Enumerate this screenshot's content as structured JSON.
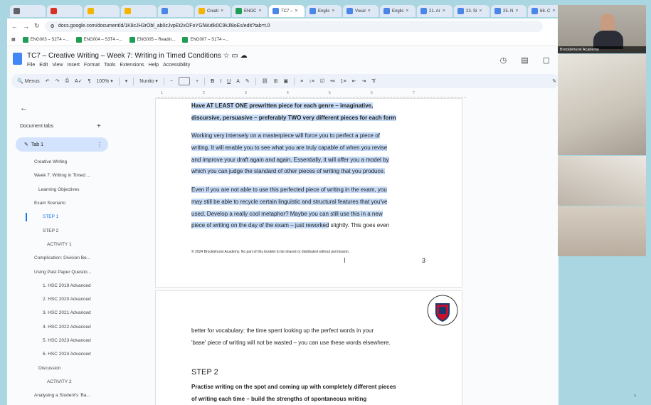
{
  "browser": {
    "tabs": [
      {
        "label": ""
      },
      {
        "label": ""
      },
      {
        "label": ""
      },
      {
        "label": ""
      },
      {
        "label": ""
      },
      {
        "label": "Creati"
      },
      {
        "label": "ENGC"
      },
      {
        "label": "TC7 –"
      },
      {
        "label": "Englis"
      },
      {
        "label": "Vocal"
      },
      {
        "label": "Englis"
      },
      {
        "label": "21. Ar"
      },
      {
        "label": "23. Si"
      },
      {
        "label": "25. N"
      },
      {
        "label": "68. C"
      },
      {
        "label": "75. E"
      }
    ],
    "url": "docs.google.com/document/d/1K8cJH3rObl_ab0zJvpEt2xOFoYGlWutlk0C9kJl8oEs/edit?tab=t.0",
    "bookmarks": [
      "ENG003 – S2T4 –...",
      "ENG004 – S3T4 –...",
      "ENG005 – Readin...",
      "ENG007 – S1T4 –..."
    ]
  },
  "doc": {
    "title": "TC7 – Creative Writing – Week 7: Writing in Timed Conditions",
    "menus": [
      "File",
      "Edit",
      "View",
      "Insert",
      "Format",
      "Tools",
      "Extensions",
      "Help",
      "Accessibility"
    ],
    "toolbar": {
      "search": "Menus",
      "zoom": "100%",
      "font": "Nunito"
    }
  },
  "ruler": [
    "1",
    "2",
    "3",
    "4",
    "5",
    "6",
    "7"
  ],
  "sidebar": {
    "header": "Document tabs",
    "add_icon": "+",
    "current_tab": "Tab 1",
    "outline": [
      "Creative Writing",
      "Week 7: Writing in Timed ...",
      "Learning Objectives",
      "Exam Scenario",
      "STEP 1",
      "STEP 2",
      "ACTIVITY 1",
      "Complication: Division Be...",
      "Using Past Paper Questio...",
      "1. HSC 2019 Advanced",
      "2. HSC 2020 Advanced",
      "3. HSC 2021 Advanced",
      "4. HSC 2022 Advanced",
      "5. HSC 2023 Advanced",
      "6. HSC 2024 Advanced",
      "Discussion",
      "ACTIVITY 2",
      "Analysing a Student's 'Ba...",
      "Echoes"
    ]
  },
  "page1": {
    "heading_line1": "Have AT LEAST ONE prewritten piece for each genre – imaginative,",
    "heading_line2": "discursive, persuasive – preferably TWO very different pieces for each form",
    "para1": [
      "Working very intensely on a masterpiece will force you to perfect a piece of",
      "writing. It will enable you to see what you are truly capable of when you revise",
      "and improve your draft again and again. Essentially, it will offer you a model by",
      "which you can judge the standard of other pieces of writing that you produce."
    ],
    "para2": [
      "Even if you are not able to use this perfected piece of writing in the exam, you",
      "may still be able to recycle certain linguistic and structural features that you've",
      "used. Develop a really cool metaphor? Maybe you can still use this in a new"
    ],
    "para2_last_highlighted": "piece of writing on the day of the exam – just reworked",
    "para2_last_rest": " slightly. This goes even",
    "footer": "© 2024 Brocklehurst Academy. No part of this booklet to be shared or distributed without permission.",
    "page_number": "3"
  },
  "page2": {
    "para1": [
      "better for vocabulary: the time spent looking up the perfect words in your",
      "'base' piece of writing will not be wasted – you can use these words elsewhere."
    ],
    "step_heading": "STEP 2",
    "bold_lines": [
      "Practise writing on the spot and coming up with completely different pieces",
      "of writing each time – build the strengths of spontaneous writing"
    ],
    "logo_text": "BROCKLEHURST ACADEMY"
  },
  "video": {
    "label": "Brocklehurst Academy"
  }
}
